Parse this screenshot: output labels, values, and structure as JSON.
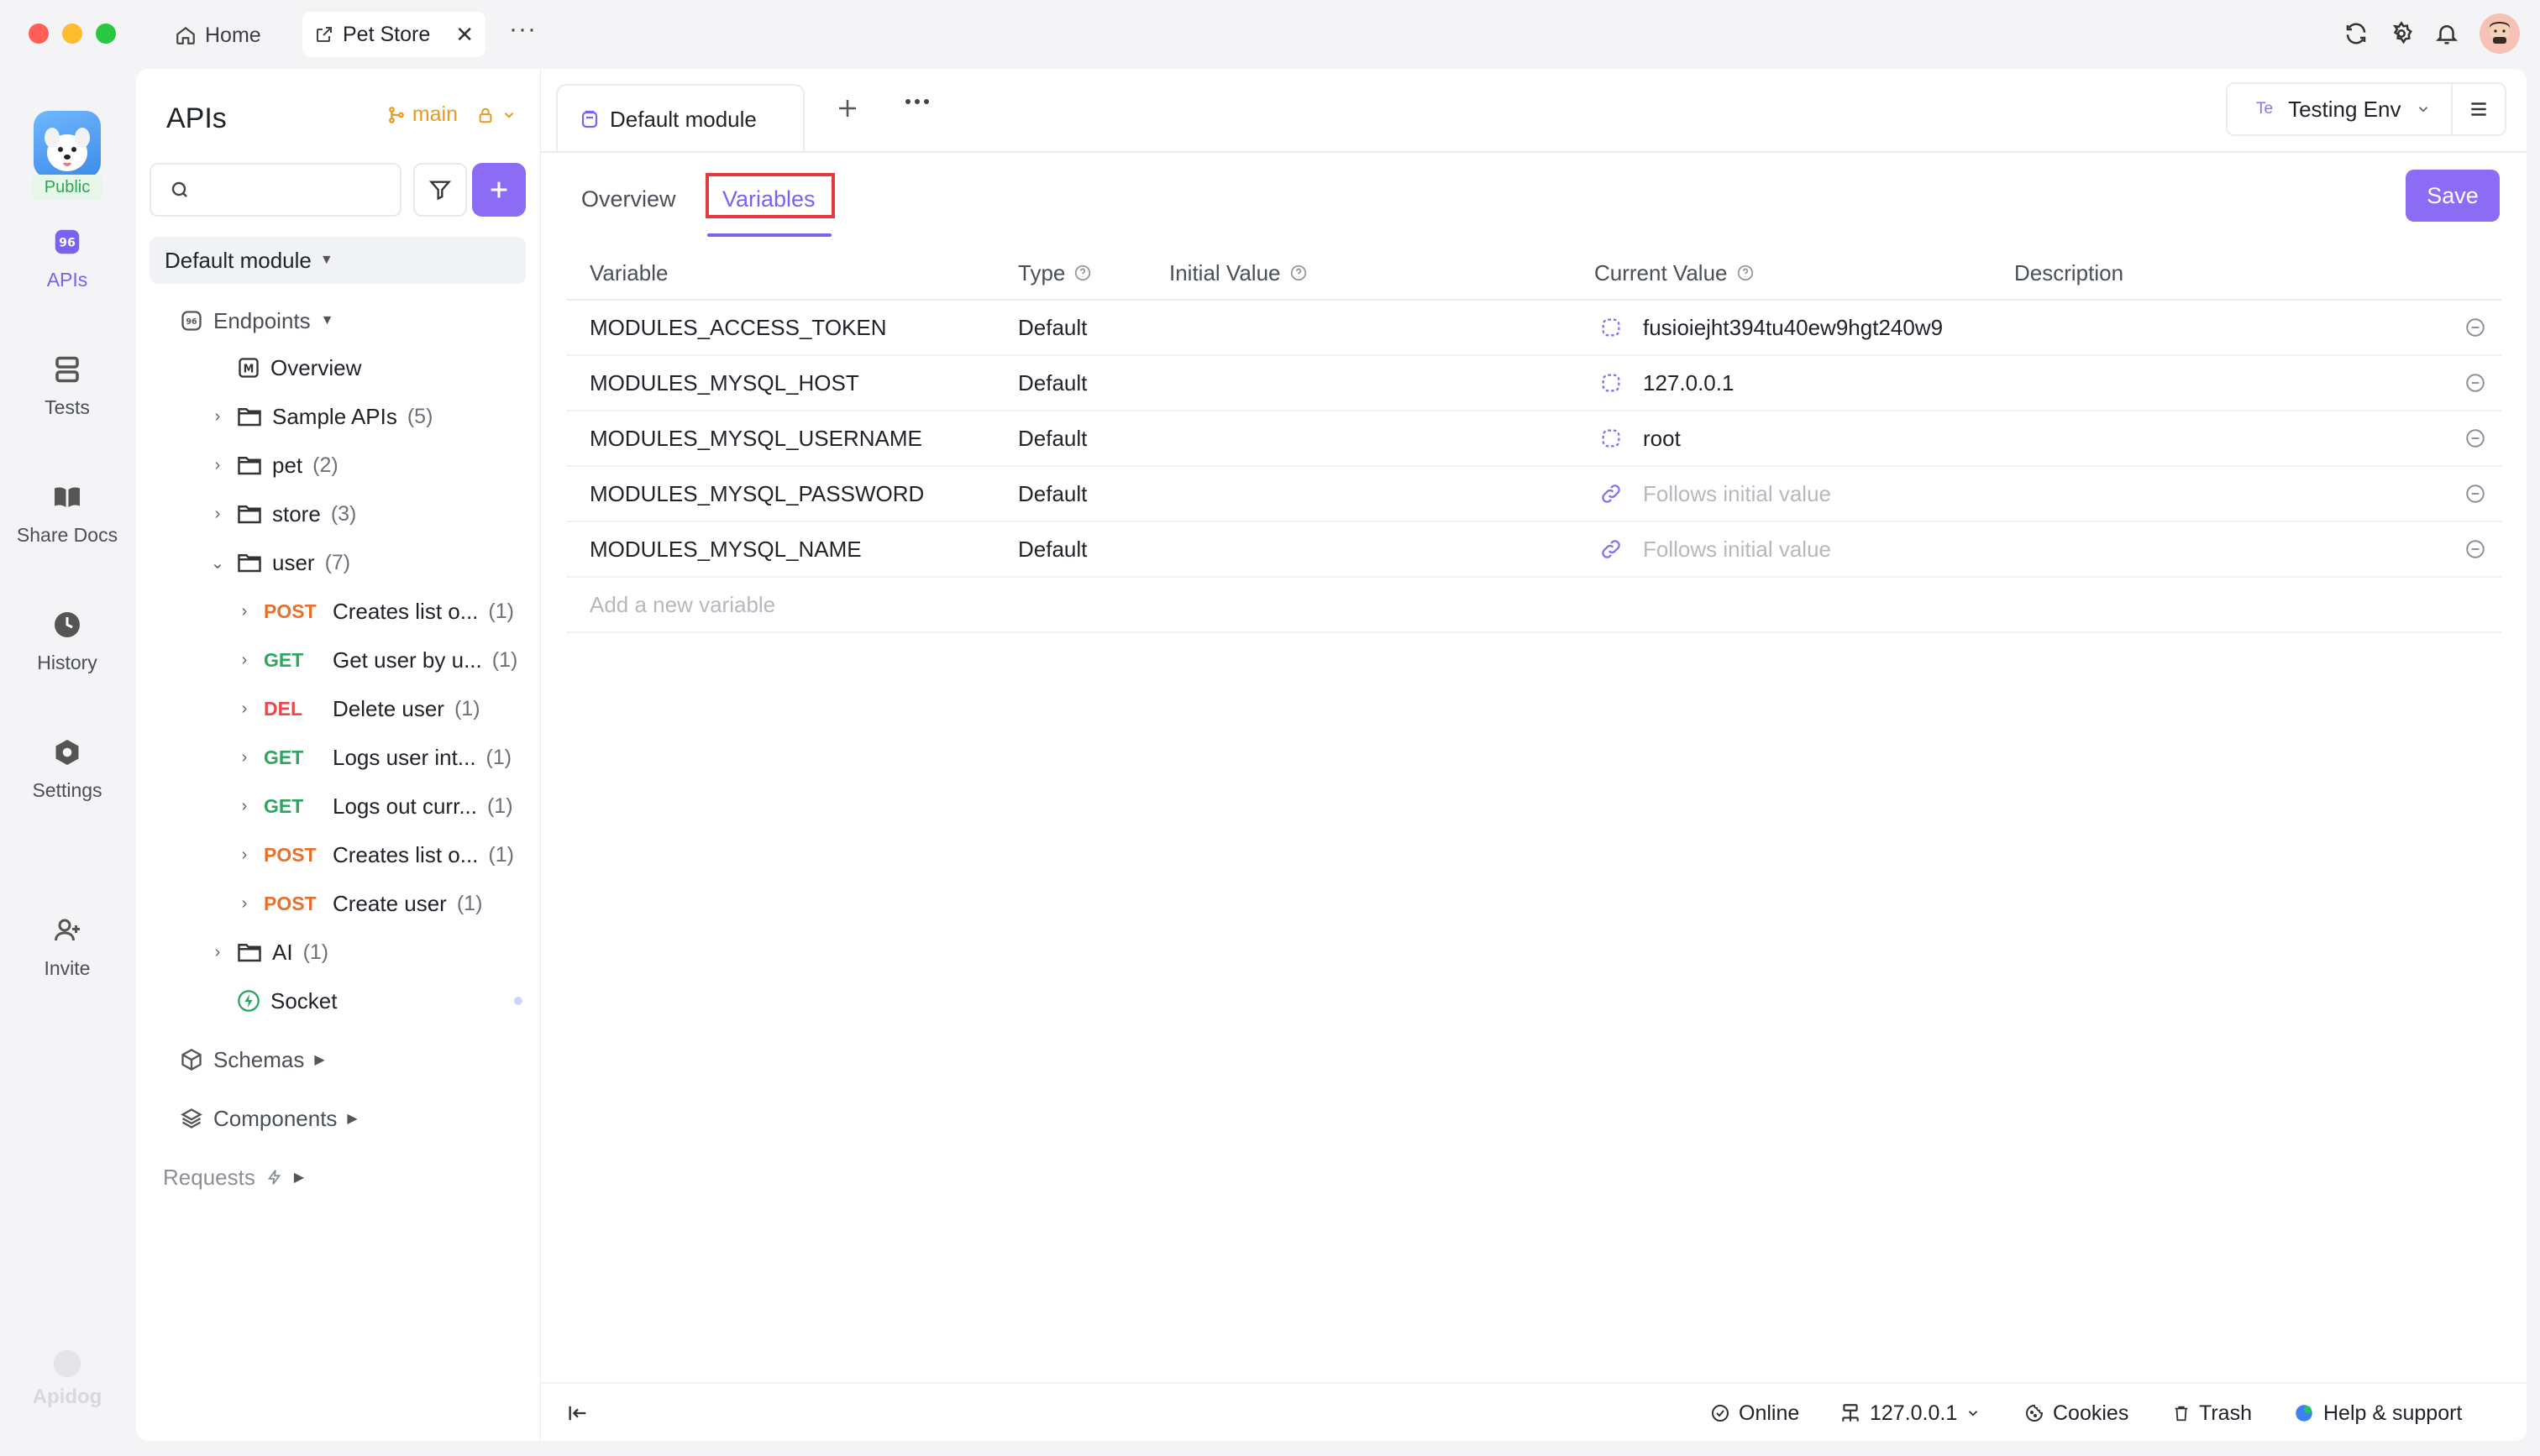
{
  "window": {
    "tabs": [
      {
        "label": "Home"
      },
      {
        "label": "Pet Store"
      }
    ],
    "more": "···"
  },
  "rail": {
    "badge": "Public",
    "items": [
      {
        "label": "APIs"
      },
      {
        "label": "Tests"
      },
      {
        "label": "Share Docs"
      },
      {
        "label": "History"
      },
      {
        "label": "Settings"
      },
      {
        "label": "Invite"
      }
    ],
    "brand": "Apidog"
  },
  "sidebar": {
    "title": "APIs",
    "branch": "main",
    "search_placeholder": "",
    "module": "Default module",
    "endpoints_label": "Endpoints",
    "overview_label": "Overview",
    "folders": [
      {
        "name": "Sample APIs",
        "count": "(5)"
      },
      {
        "name": "pet",
        "count": "(2)"
      },
      {
        "name": "store",
        "count": "(3)"
      },
      {
        "name": "user",
        "count": "(7)"
      }
    ],
    "user_endpoints": [
      {
        "method": "POST",
        "name": "Creates list o...",
        "count": "(1)"
      },
      {
        "method": "GET",
        "name": "Get user by u...",
        "count": "(1)"
      },
      {
        "method": "DEL",
        "name": "Delete user",
        "count": "(1)"
      },
      {
        "method": "GET",
        "name": "Logs user int...",
        "count": "(1)"
      },
      {
        "method": "GET",
        "name": "Logs out curr...",
        "count": "(1)"
      },
      {
        "method": "POST",
        "name": "Creates list o...",
        "count": "(1)"
      },
      {
        "method": "POST",
        "name": "Create user",
        "count": "(1)"
      }
    ],
    "ai_folder": {
      "name": "AI",
      "count": "(1)"
    },
    "socket_label": "Socket",
    "schemas_label": "Schemas",
    "components_label": "Components",
    "requests_label": "Requests"
  },
  "main": {
    "doc_tab": "Default module",
    "env": {
      "badge": "Te",
      "label": "Testing Env"
    },
    "tabs": [
      {
        "label": "Overview"
      },
      {
        "label": "Variables"
      }
    ],
    "save_label": "Save",
    "table": {
      "headers": {
        "variable": "Variable",
        "type": "Type",
        "initial": "Initial Value",
        "current": "Current Value",
        "description": "Description"
      },
      "rows": [
        {
          "variable": "MODULES_ACCESS_TOKEN",
          "type": "Default",
          "initial": "",
          "current": "fusioiejht394tu40ew9hgt240w9",
          "current_muted": false,
          "icon": "unlink-icon"
        },
        {
          "variable": "MODULES_MYSQL_HOST",
          "type": "Default",
          "initial": "",
          "current": "127.0.0.1",
          "current_muted": false,
          "icon": "unlink-icon"
        },
        {
          "variable": "MODULES_MYSQL_USERNAME",
          "type": "Default",
          "initial": "",
          "current": "root",
          "current_muted": false,
          "icon": "unlink-icon"
        },
        {
          "variable": "MODULES_MYSQL_PASSWORD",
          "type": "Default",
          "initial": "",
          "current": "Follows initial value",
          "current_muted": true,
          "icon": "link-icon"
        },
        {
          "variable": "MODULES_MYSQL_NAME",
          "type": "Default",
          "initial": "",
          "current": "Follows initial value",
          "current_muted": true,
          "icon": "link-icon"
        }
      ],
      "add_placeholder": "Add a new variable"
    }
  },
  "footer": {
    "online": "Online",
    "server": "127.0.0.1",
    "cookies": "Cookies",
    "trash": "Trash",
    "help": "Help & support"
  },
  "colors": {
    "accent": "#8c6cf4",
    "post": "#e8702a",
    "get": "#2ea55f",
    "delete": "#e5484d",
    "branch": "#e69a22",
    "highlight": "#e5393f"
  }
}
